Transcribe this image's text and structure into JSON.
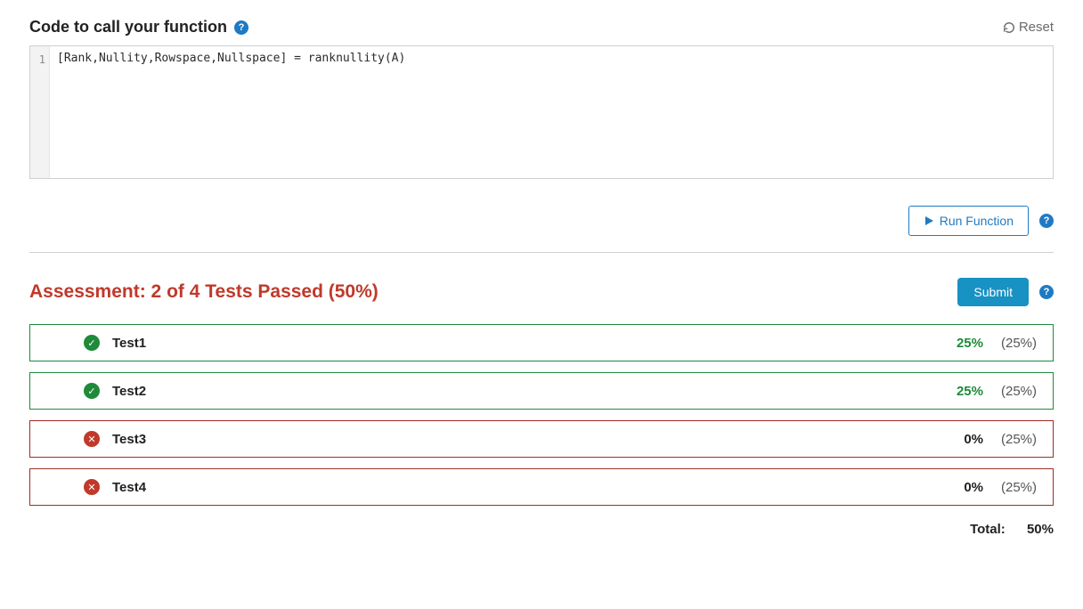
{
  "header": {
    "title": "Code to call your function",
    "reset_label": "Reset"
  },
  "editor": {
    "line_numbers": [
      "1"
    ],
    "code": "[Rank,Nullity,Rowspace,Nullspace] = ranknullity(A)"
  },
  "run_button_label": "Run Function",
  "assessment": {
    "title": "Assessment: 2 of 4 Tests Passed (50%)",
    "submit_label": "Submit",
    "tests": [
      {
        "name": "Test1",
        "passed": true,
        "score": "25%",
        "weight": "(25%)"
      },
      {
        "name": "Test2",
        "passed": true,
        "score": "25%",
        "weight": "(25%)"
      },
      {
        "name": "Test3",
        "passed": false,
        "score": "0%",
        "weight": "(25%)"
      },
      {
        "name": "Test4",
        "passed": false,
        "score": "0%",
        "weight": "(25%)"
      }
    ],
    "total_label": "Total:",
    "total_value": "50%"
  }
}
